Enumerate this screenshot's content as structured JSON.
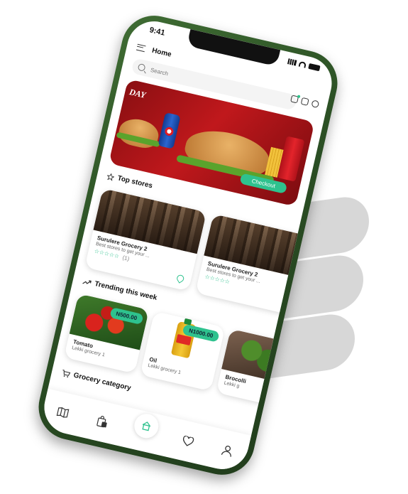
{
  "status": {
    "time": "9:41"
  },
  "header": {
    "title": "Home"
  },
  "search": {
    "placeholder": "Search"
  },
  "banner": {
    "title": "DAY",
    "checkout_label": "Checkout"
  },
  "sections": {
    "top_stores": "Top stores",
    "trending": "Trending this week",
    "grocery_category": "Grocery category"
  },
  "stores": [
    {
      "name": "Surulere Grocery 2",
      "desc": "Best stores to get your ...",
      "stars": "☆☆☆☆☆",
      "rating_count": "(1)"
    },
    {
      "name": "Surulere Grocery 2",
      "desc": "Best stores to get your ...",
      "stars": "☆☆☆☆☆",
      "rating_count": ""
    }
  ],
  "products": [
    {
      "name": "Tomato",
      "store": "Lekki grocery 1",
      "price": "N500.00"
    },
    {
      "name": "Oil",
      "store": "Lekki grocery 1",
      "price": "N1000.00"
    },
    {
      "name": "Brocolli",
      "store": "Lekki g",
      "price": ""
    }
  ],
  "colors": {
    "accent": "#2ec28e",
    "phone_frame": "#2c5125",
    "banner_red": "#c0181c"
  },
  "icons": {
    "nav": [
      "map-icon",
      "shopping-bag-icon",
      "home-icon",
      "heart-icon",
      "user-icon"
    ],
    "header": [
      "menu-icon",
      "notification-icon",
      "cart-icon",
      "profile-icon"
    ]
  }
}
